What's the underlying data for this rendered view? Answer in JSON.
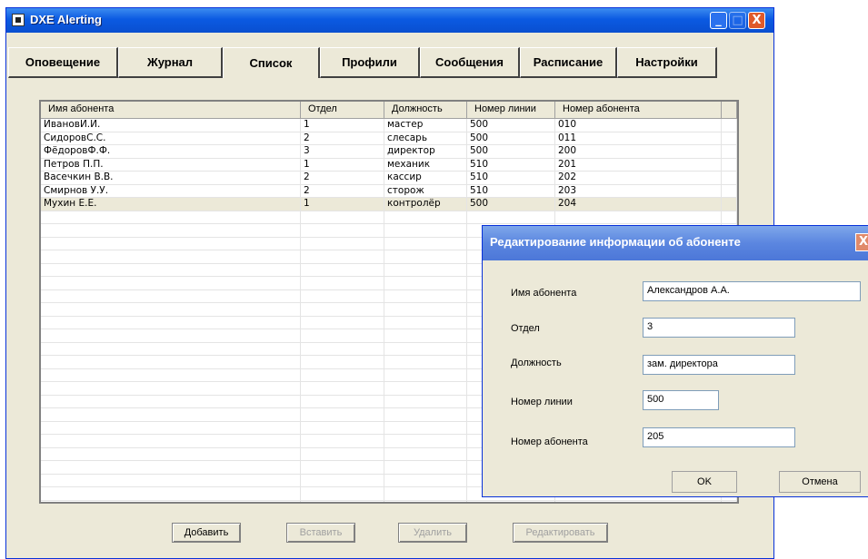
{
  "window": {
    "title": "DXE Alerting",
    "min": "_",
    "max": "□",
    "close": "X"
  },
  "tabs": [
    {
      "label": "Оповещение"
    },
    {
      "label": "Журнал"
    },
    {
      "label": "Список",
      "active": true
    },
    {
      "label": "Профили"
    },
    {
      "label": "Сообщения"
    },
    {
      "label": "Расписание"
    },
    {
      "label": "Настройки"
    }
  ],
  "list": {
    "columns": [
      "Имя абонента",
      "Отдел",
      "Должность",
      "Номер линии",
      "Номер абонента"
    ],
    "rows": [
      [
        "ИвановИ.И.",
        "1",
        "мастер",
        "500",
        "010"
      ],
      [
        "СидоровС.С.",
        "2",
        "слесарь",
        "500",
        "011"
      ],
      [
        "ФёдоровФ.Ф.",
        "3",
        "директор",
        "500",
        "200"
      ],
      [
        "Петров П.П.",
        "1",
        "механик",
        "510",
        "201"
      ],
      [
        "Васечкин В.В.",
        "2",
        "кассир",
        "510",
        "202"
      ],
      [
        "Смирнов У.У.",
        "2",
        "сторож",
        "510",
        "203"
      ],
      [
        "Мухин Е.Е.",
        "1",
        "контролёр",
        "500",
        "204"
      ]
    ],
    "selected_row": 6
  },
  "buttons": {
    "add": "Добавить",
    "insert": "Вставить",
    "delete": "Удалить",
    "edit": "Редактировать"
  },
  "dialog": {
    "title": "Редактирование информации об абоненте",
    "close": "X",
    "fields": {
      "name_label": "Имя абонента",
      "name_value": "Александров А.А.",
      "dept_label": "Отдел",
      "dept_value": "3",
      "position_label": "Должность",
      "position_value": "зам. директора",
      "line_label": "Номер линии",
      "line_value": "500",
      "number_label": "Номер абонента",
      "number_value": "205"
    },
    "ok": "OK",
    "cancel": "Отмена"
  }
}
